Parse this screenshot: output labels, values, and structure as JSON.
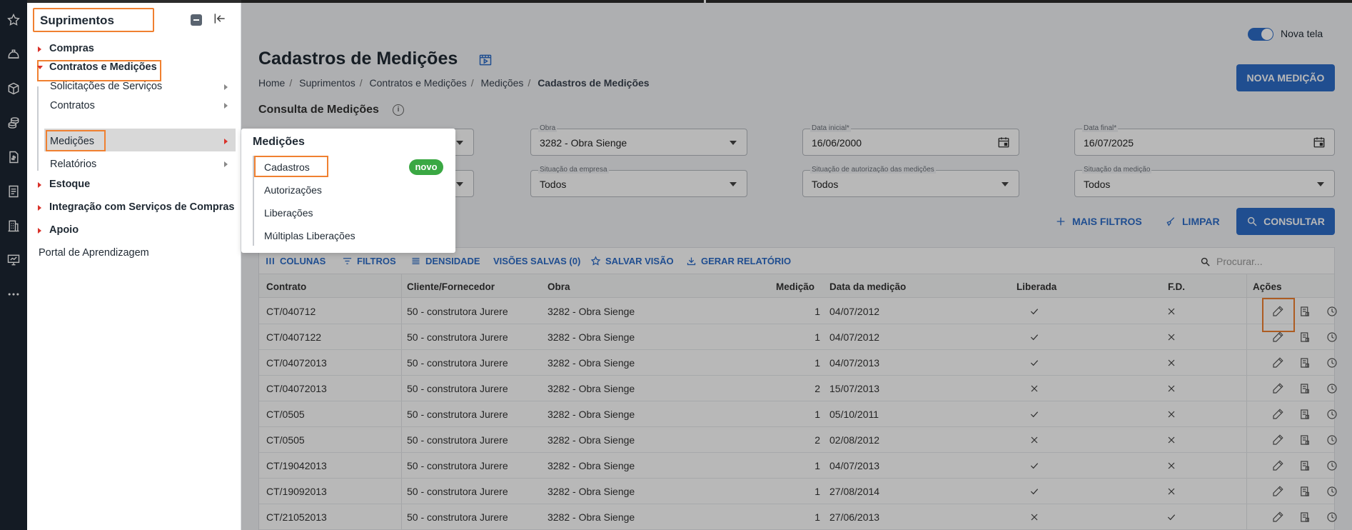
{
  "rail": {
    "icons": [
      "star-icon",
      "helmet-icon",
      "box-icon",
      "coins-icon",
      "document-dollar-icon",
      "list-document-icon",
      "building-icon",
      "monitor-icon",
      "more-icon"
    ]
  },
  "sidebar": {
    "title": "Suprimentos",
    "items": [
      {
        "label": "Compras"
      },
      {
        "label": "Contratos e Medições"
      },
      {
        "label": "Solicitações de Serviços"
      },
      {
        "label": "Contratos"
      },
      {
        "label": "Medições"
      },
      {
        "label": "Relatórios"
      },
      {
        "label": "Estoque"
      },
      {
        "label": "Integração com Serviços de Compras"
      },
      {
        "label": "Apoio"
      },
      {
        "label": "Portal de Aprendizagem"
      }
    ]
  },
  "flyout": {
    "title": "Medições",
    "items": [
      {
        "label": "Cadastros"
      },
      {
        "label": "Autorizações"
      },
      {
        "label": "Liberações"
      },
      {
        "label": "Múltiplas Liberações"
      }
    ],
    "badge": "novo"
  },
  "header": {
    "toggle_label": "Nova tela",
    "title": "Cadastros de Medições",
    "breadcrumb": [
      "Home",
      "Suprimentos",
      "Contratos e Medições",
      "Medições",
      "Cadastros de Medições"
    ],
    "breadcrumb_sep": "/",
    "new_button": "NOVA MEDIÇÃO"
  },
  "filters": {
    "section_title": "Consulta de Medições",
    "obra_label": "Obra",
    "obra_value": "3282 - Obra Sienge",
    "data_inicial_label": "Data inicial*",
    "data_inicial_value": "16/06/2000",
    "data_final_label": "Data final*",
    "data_final_value": "16/07/2025",
    "situacao_empresa_label": "Situação da empresa",
    "situacao_empresa_value": "Todos",
    "situacao_autorizacao_label": "Situação de autorização das medições",
    "situacao_autorizacao_value": "Todos",
    "situacao_medicao_label": "Situação da medição",
    "situacao_medicao_value": "Todos",
    "mais_filtros": "MAIS FILTROS",
    "limpar": "LIMPAR",
    "consultar": "CONSULTAR"
  },
  "grid": {
    "toolbar": {
      "colunas": "COLUNAS",
      "filtros": "FILTROS",
      "densidade": "DENSIDADE",
      "visoes_salvas": "VISÕES SALVAS (0)",
      "salvar_visao": "SALVAR VISÃO",
      "gerar_relatorio": "GERAR RELATÓRIO",
      "search_placeholder": "Procurar..."
    },
    "columns": [
      "Contrato",
      "Cliente/Fornecedor",
      "Obra",
      "Medição",
      "Data da medição",
      "Liberada",
      "F.D.",
      "Ações"
    ],
    "rows": [
      {
        "contrato": "CT/040712",
        "cliente": "50 - construtora Jurere",
        "obra": "3282 - Obra Sienge",
        "medicao": "1",
        "data": "04/07/2012",
        "liberada": true,
        "fd": false
      },
      {
        "contrato": "CT/0407122",
        "cliente": "50 - construtora Jurere",
        "obra": "3282 - Obra Sienge",
        "medicao": "1",
        "data": "04/07/2012",
        "liberada": true,
        "fd": false
      },
      {
        "contrato": "CT/04072013",
        "cliente": "50 - construtora Jurere",
        "obra": "3282 - Obra Sienge",
        "medicao": "1",
        "data": "04/07/2013",
        "liberada": true,
        "fd": false
      },
      {
        "contrato": "CT/04072013",
        "cliente": "50 - construtora Jurere",
        "obra": "3282 - Obra Sienge",
        "medicao": "2",
        "data": "15/07/2013",
        "liberada": false,
        "fd": false
      },
      {
        "contrato": "CT/0505",
        "cliente": "50 - construtora Jurere",
        "obra": "3282 - Obra Sienge",
        "medicao": "1",
        "data": "05/10/2011",
        "liberada": true,
        "fd": false
      },
      {
        "contrato": "CT/0505",
        "cliente": "50 - construtora Jurere",
        "obra": "3282 - Obra Sienge",
        "medicao": "2",
        "data": "02/08/2012",
        "liberada": false,
        "fd": false
      },
      {
        "contrato": "CT/19042013",
        "cliente": "50 - construtora Jurere",
        "obra": "3282 - Obra Sienge",
        "medicao": "1",
        "data": "04/07/2013",
        "liberada": true,
        "fd": false
      },
      {
        "contrato": "CT/19092013",
        "cliente": "50 - construtora Jurere",
        "obra": "3282 - Obra Sienge",
        "medicao": "1",
        "data": "27/08/2014",
        "liberada": true,
        "fd": false
      },
      {
        "contrato": "CT/21052013",
        "cliente": "50 - construtora Jurere",
        "obra": "3282 - Obra Sienge",
        "medicao": "1",
        "data": "27/06/2013",
        "liberada": false,
        "fd": true
      }
    ]
  },
  "colors": {
    "accent": "#2d6cc8",
    "highlight": "#f08030",
    "badge": "#3aa843",
    "rail": "#1c2633"
  }
}
